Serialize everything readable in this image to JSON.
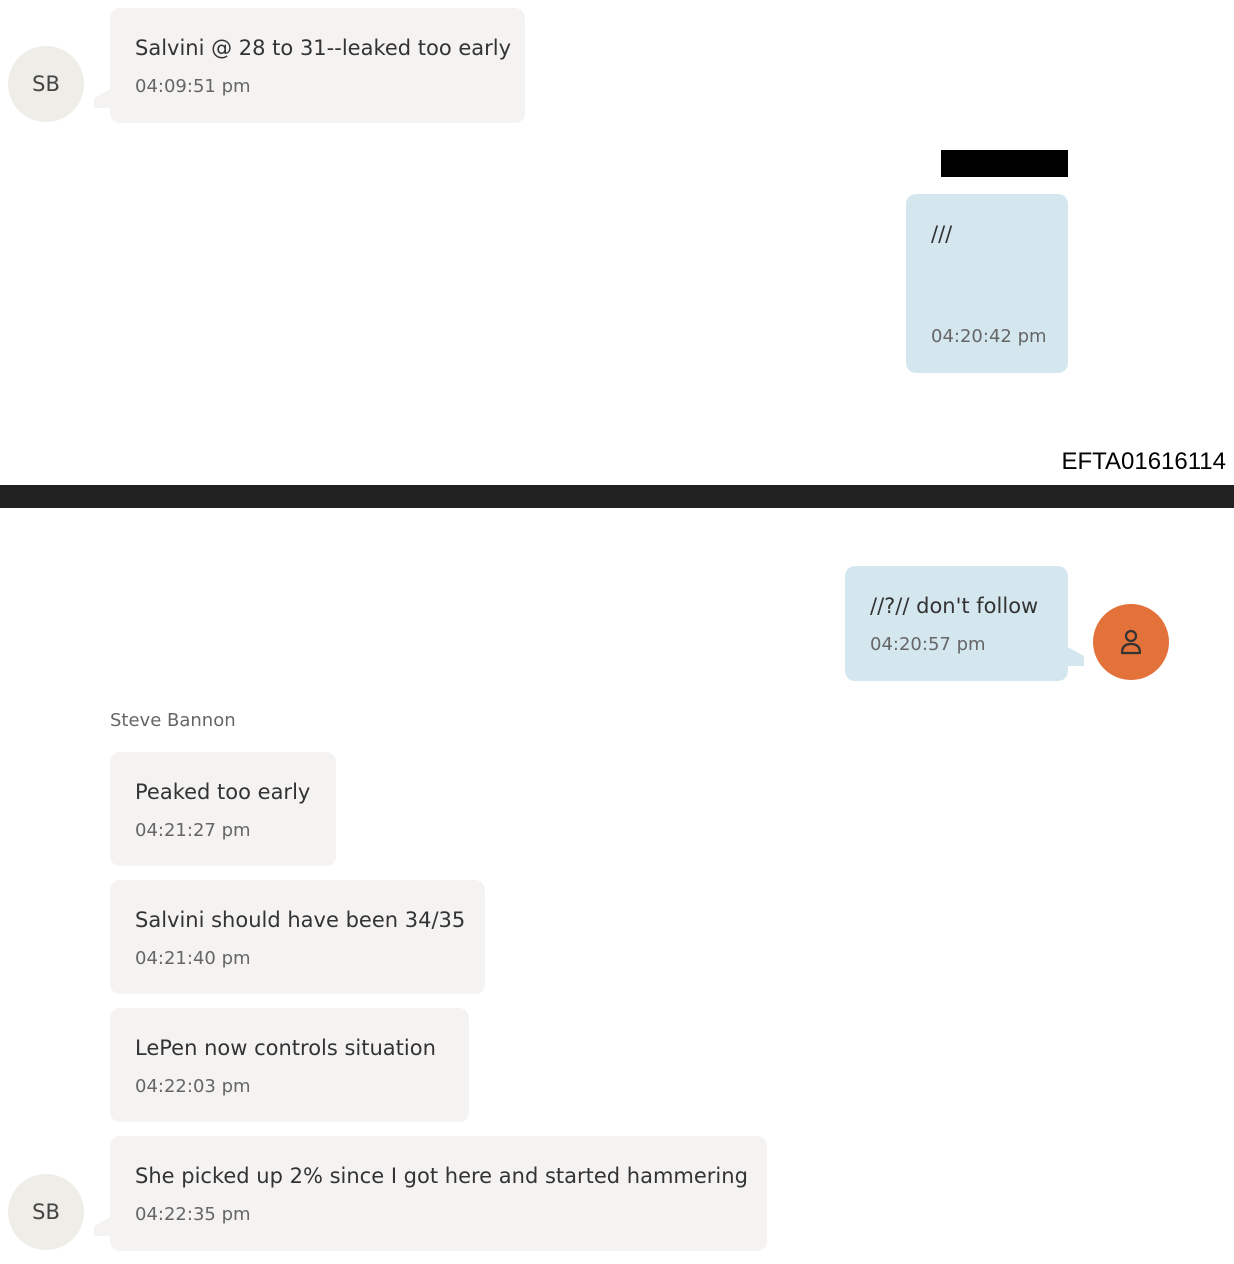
{
  "avatars": {
    "sb_initials": "SB"
  },
  "messages": {
    "m1": {
      "text": "Salvini @ 28 to 31--leaked too early",
      "time": "04:09:51 pm"
    },
    "m2": {
      "text": "///",
      "time": "04:20:42 pm"
    },
    "m3": {
      "text": "//?// don't follow",
      "time": "04:20:57 pm"
    },
    "m4": {
      "text": "Peaked too early",
      "time": "04:21:27 pm"
    },
    "m5": {
      "text": "Salvini should have been 34/35",
      "time": "04:21:40 pm"
    },
    "m6": {
      "text": "LePen now controls situation",
      "time": "04:22:03 pm"
    },
    "m7": {
      "text": "She picked up 2% since I got here and started hammering",
      "time": "04:22:35 pm"
    }
  },
  "sender_name": "Steve Bannon",
  "doc_id": "EFTA01616114",
  "colors": {
    "incoming_bubble": "#f4f3f2",
    "outgoing_bubble": "#d5e7ee",
    "user_avatar": "#e27239",
    "sb_avatar": "#eeede8",
    "page_break": "#212121"
  }
}
